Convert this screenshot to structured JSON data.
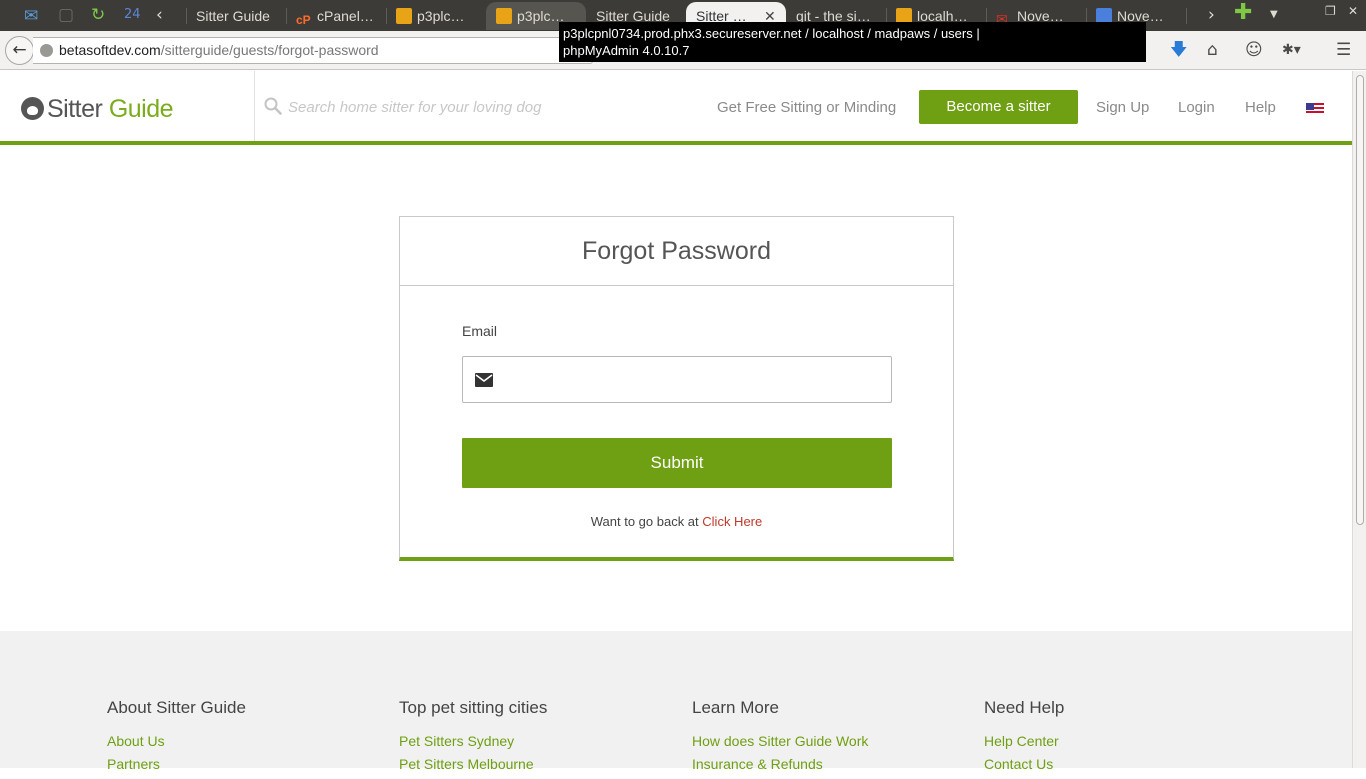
{
  "browser": {
    "tabs": [
      {
        "label": "",
        "icon": "mail-icon"
      },
      {
        "label": "",
        "icon": "blank-tab-icon"
      },
      {
        "label": "",
        "icon": "reload-icon"
      },
      {
        "label": "",
        "icon": "app-24-icon"
      },
      {
        "label": "Sitter Guide",
        "icon": ""
      },
      {
        "label": "cPanel…",
        "icon": "cpanel-icon"
      },
      {
        "label": "p3plc…",
        "icon": "phpmyadmin-icon"
      },
      {
        "label": "p3plc…",
        "icon": "phpmyadmin-icon"
      },
      {
        "label": "Sitter Guide",
        "icon": ""
      },
      {
        "label": "Sitter …",
        "icon": ""
      },
      {
        "label": "git - the si…",
        "icon": ""
      },
      {
        "label": "localh…",
        "icon": "phpmyadmin-icon"
      },
      {
        "label": "Nove…",
        "icon": "gmail-icon"
      },
      {
        "label": "Nove…",
        "icon": "docs-icon"
      }
    ],
    "url_host": "betasoftdev.com",
    "url_path": "/sitterguide/guests/forgot-password",
    "tooltip_line1": "p3plcpnl0734.prod.phx3.secureserver.net / localhost / madpaws / users |",
    "tooltip_line2": "phpMyAdmin 4.0.10.7"
  },
  "header": {
    "logo_word1": "Sitter",
    "logo_word2": "Guide",
    "search_placeholder": "Search home sitter for your loving dog",
    "nav": {
      "free_sitting": "Get Free Sitting or Minding",
      "become_sitter": "Become a sitter",
      "sign_up": "Sign Up",
      "login": "Login",
      "help": "Help"
    },
    "flag_icon": "us-flag-icon"
  },
  "form": {
    "title": "Forgot Password",
    "email_label": "Email",
    "email_value": "",
    "submit_label": "Submit",
    "go_back_text": "Want to go back at",
    "click_here": "Click Here"
  },
  "footer": {
    "columns": [
      {
        "heading": "About Sitter Guide",
        "links": [
          "About Us",
          "Partners"
        ]
      },
      {
        "heading": "Top pet sitting cities",
        "links": [
          "Pet Sitters Sydney",
          "Pet Sitters Melbourne"
        ]
      },
      {
        "heading": "Learn More",
        "links": [
          "How does Sitter Guide Work",
          "Insurance & Refunds"
        ]
      },
      {
        "heading": "Need Help",
        "links": [
          "Help Center",
          "Contact Us"
        ]
      }
    ]
  },
  "colors": {
    "brand_green": "#6f9f12",
    "link_red": "#c0392b"
  }
}
